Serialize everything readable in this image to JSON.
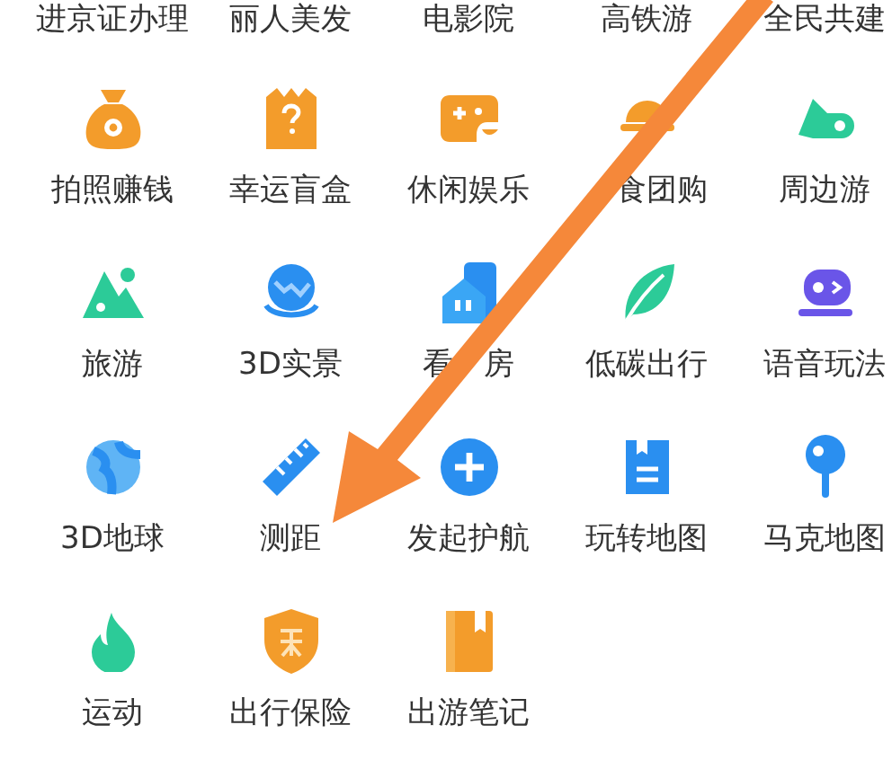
{
  "top_row_labels": [
    "进京证办理",
    "丽人美发",
    "电影院",
    "高铁游",
    "全民共建"
  ],
  "rows": [
    {
      "items": [
        "拍照赚钱",
        "幸运盲盒",
        "休闲娱乐",
        "　食团购",
        "周边游"
      ]
    },
    {
      "items": [
        "旅游",
        "3D实景",
        "看　房",
        "低碳出行",
        "语音玩法"
      ]
    },
    {
      "items": [
        "3D地球",
        "测距",
        "发起护航",
        "玩转地图",
        "马克地图"
      ]
    },
    {
      "items": [
        "运动",
        "出行保险",
        "出游笔记"
      ]
    }
  ]
}
